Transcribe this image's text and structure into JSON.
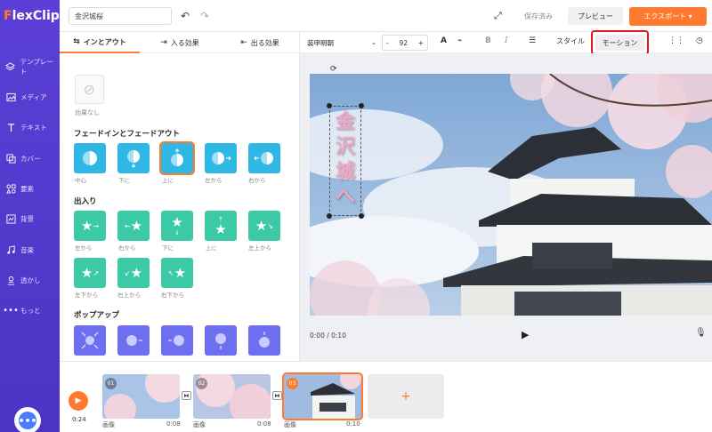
{
  "app": {
    "logo": "FlexClip",
    "logo_first": "F",
    "logo_rest": "lexClip",
    "accent": "#ff7a2f",
    "sidebar_color": "#5b3fd6"
  },
  "sidebar": {
    "items": [
      {
        "label": "テンプレート",
        "icon": "layers-icon"
      },
      {
        "label": "メディア",
        "icon": "media-icon"
      },
      {
        "label": "テキスト",
        "icon": "text-icon"
      },
      {
        "label": "カバー",
        "icon": "cover-icon"
      },
      {
        "label": "要素",
        "icon": "elements-icon"
      },
      {
        "label": "背景",
        "icon": "background-icon"
      },
      {
        "label": "音楽",
        "icon": "music-icon"
      },
      {
        "label": "透かし",
        "icon": "watermark-icon"
      },
      {
        "label": "もっと",
        "icon": "more-icon"
      }
    ]
  },
  "topbar": {
    "project_title": "金沢城桜",
    "saved_label": "保存済み",
    "preview_label": "プレビュー",
    "export_label": "エクスポート ▾"
  },
  "panel": {
    "tabs": [
      {
        "label": "インとアウト",
        "icon": "in-out-icon",
        "active": true
      },
      {
        "label": "入る効果",
        "icon": "enter-icon",
        "active": false
      },
      {
        "label": "出る効果",
        "icon": "exit-icon",
        "active": false
      }
    ],
    "none_label": "効果なし",
    "sections": [
      {
        "title": "フェードインとフェードアウト",
        "color": "#2fb8e6",
        "items": [
          {
            "label": "中心",
            "arrow": ""
          },
          {
            "label": "下に",
            "arrow": "↓"
          },
          {
            "label": "上に",
            "arrow": "↑",
            "selected": true
          },
          {
            "label": "左から",
            "arrow": "→"
          },
          {
            "label": "右から",
            "arrow": "←"
          }
        ]
      },
      {
        "title": "出入り",
        "color": "#3ccaa6",
        "items": [
          {
            "label": "左から",
            "arrow": "→"
          },
          {
            "label": "右から",
            "arrow": "←"
          },
          {
            "label": "下に",
            "arrow": "↓"
          },
          {
            "label": "上に",
            "arrow": "↑"
          },
          {
            "label": "左上から",
            "arrow": "↘"
          },
          {
            "label": "左下から",
            "arrow": "↗"
          },
          {
            "label": "右上から",
            "arrow": "↙"
          },
          {
            "label": "右下から",
            "arrow": "↖"
          }
        ]
      },
      {
        "title": "ポップアップ",
        "color": "#6e6ff0",
        "items": [
          {
            "label": "",
            "arrow": ""
          },
          {
            "label": "",
            "arrow": ""
          },
          {
            "label": "",
            "arrow": ""
          },
          {
            "label": "",
            "arrow": ""
          },
          {
            "label": "",
            "arrow": ""
          }
        ]
      }
    ]
  },
  "format_bar": {
    "font": "装甲明朝",
    "font_size": "92",
    "minus": "-",
    "plus": "+",
    "style_label": "スタイル",
    "motion_label": "モーション"
  },
  "canvas": {
    "overlay_text": "金沢城へ",
    "time": "0:00 / 0:10"
  },
  "timeline": {
    "total_time": "0:24",
    "clips": [
      {
        "num": "01",
        "label": "画像",
        "duration": "0:08"
      },
      {
        "num": "02",
        "label": "画像",
        "duration": "0:08"
      },
      {
        "num": "03",
        "label": "画像",
        "duration": "0:10",
        "selected": true
      }
    ],
    "add_label": "+"
  }
}
